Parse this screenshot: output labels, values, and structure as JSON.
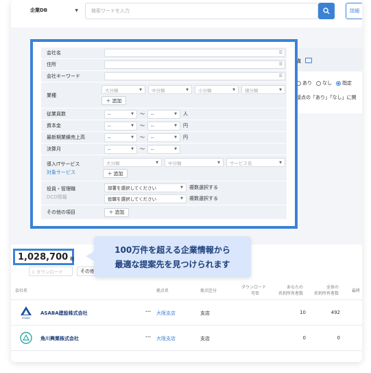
{
  "header": {
    "db_select": "企業DB",
    "search_placeholder": "検索ワードを入力",
    "detail_button": "詳細"
  },
  "form": {
    "company_name": "会社名",
    "address": "住所",
    "company_keyword": "会社キーワード",
    "industry": "業種",
    "industry_selects": [
      "大分類",
      "中分類",
      "小分類",
      "細分類"
    ],
    "add_label": "追加",
    "employees": "従業員数",
    "capital": "資本金",
    "revenue": "最新期業績売上高",
    "fiscal_month": "決算月",
    "range_placeholder": "--",
    "tilde": "〜",
    "unit_people": "人",
    "unit_yen": "円",
    "it_service": "導入ITサービス",
    "it_service_sub": "対象サービス",
    "it_selects": [
      "大分類",
      "中分類",
      "サービス名"
    ],
    "officer": "役員・管理職",
    "officer_sub": "DCD情報",
    "dept_select": "部署を選択してください",
    "role_select": "役職を選択してください",
    "multi_select": "複数選択する",
    "other_items": "その他の項目"
  },
  "right_panel": {
    "title": "接点",
    "radio_yes": "あり",
    "radio_no": "なし",
    "radio_specified": "指定",
    "note": "接点の「あり」「なし」に関"
  },
  "results": {
    "count": "1,028,700",
    "count_unit": "社",
    "callout_line1": "100万件を超える企業情報から",
    "callout_line2": "最適な提案先を見つけられます",
    "download_button": "ダウンロード",
    "other_select": "その他",
    "columns": {
      "company": "会社名",
      "branch": "拠点名",
      "branch_kind": "拠点区分",
      "downloadable_1": "ダウンロード",
      "downloadable_2": "可否",
      "own_holders_1": "あなたの",
      "own_holders_2": "名刺所有者数",
      "all_holders_1": "全体の",
      "all_holders_2": "名刺所有者数",
      "last": "最終"
    },
    "rows": [
      {
        "name": "ASABA建設株式会社",
        "branch": "大阪支店",
        "kind": "支店",
        "own": "10",
        "all": "492"
      },
      {
        "name": "角川興業株式会社",
        "branch": "大阪支店",
        "kind": "支店",
        "own": "0",
        "all": "0"
      }
    ],
    "logo_text": "ASABA"
  },
  "colors": {
    "accent": "#3b82d6",
    "callout_bg": "#d9e6fb",
    "label_bg": "#eef1f5"
  }
}
